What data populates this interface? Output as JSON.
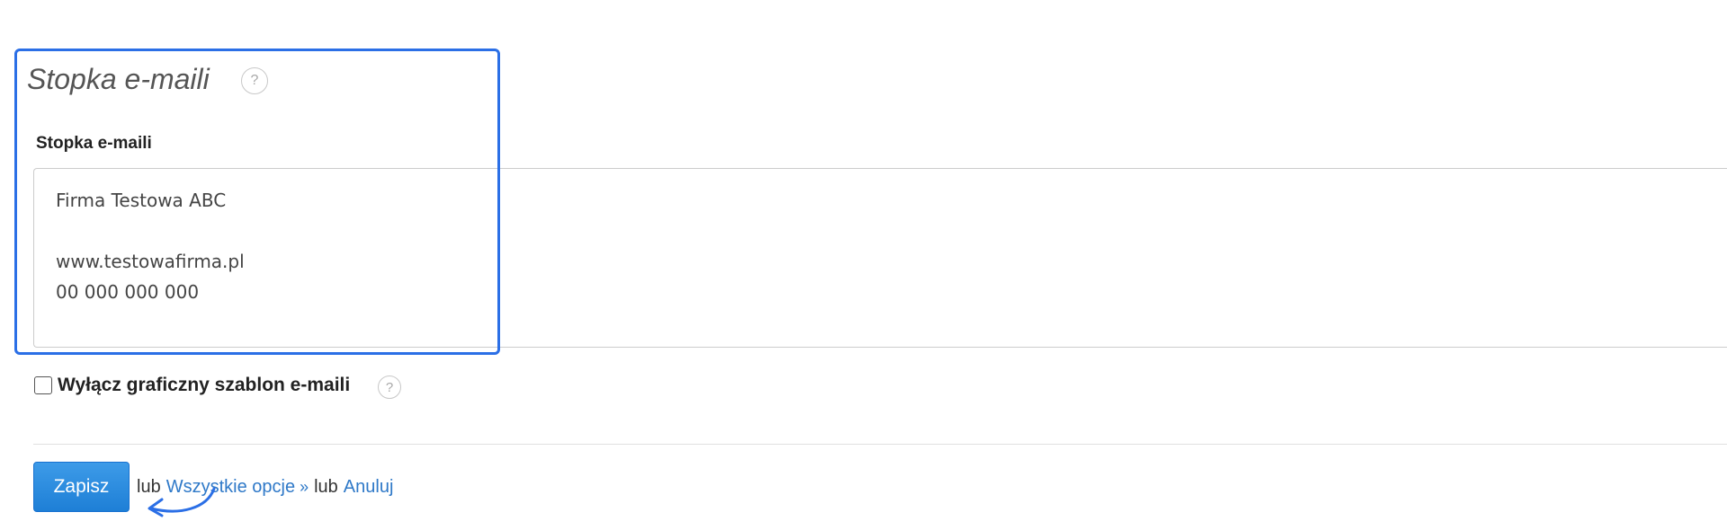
{
  "section": {
    "title": "Stopka e-maili",
    "help_glyph": "?"
  },
  "field": {
    "label": "Stopka e-maili",
    "value": "Firma Testowa ABC\n\nwww.testowafirma.pl\n00 000 000 000"
  },
  "checkbox": {
    "label": "Wyłącz graficzny szablon e-maili",
    "checked": false,
    "help_glyph": "?"
  },
  "actions": {
    "save_label": "Zapisz",
    "or_text_1": "lub",
    "all_options_label": "Wszystkie opcje",
    "raquo": "»",
    "or_text_2": "lub",
    "cancel_label": "Anuluj"
  },
  "annotation": {
    "highlight_color": "#2b6fe6",
    "arrow_icon": "curved-arrow-icon"
  },
  "colors": {
    "primary_button": "#1e7fd6",
    "link": "#2f79c8"
  }
}
